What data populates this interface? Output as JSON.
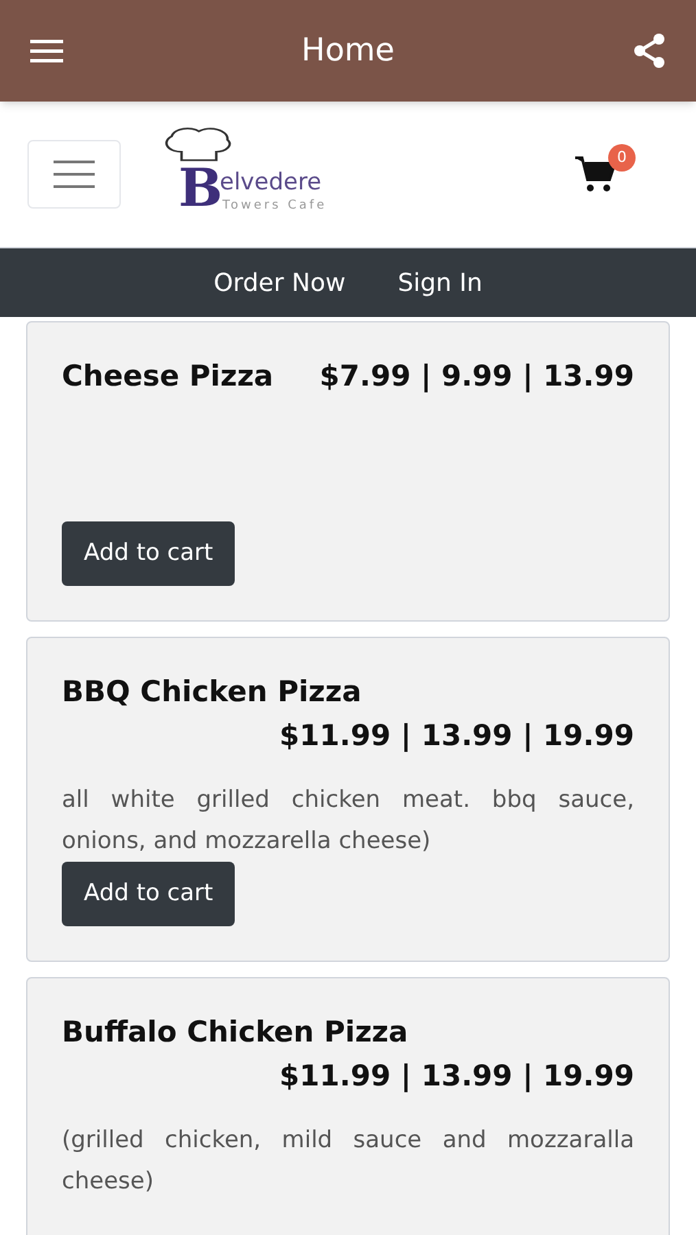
{
  "app_bar": {
    "title": "Home"
  },
  "logo": {
    "initial": "B",
    "rest": "elvedere",
    "tagline": "Towers Cafe"
  },
  "cart": {
    "count": "0"
  },
  "nav": [
    "Order Now",
    "Sign In"
  ],
  "items": [
    {
      "name": "Cheese Pizza",
      "price": "$7.99 | 9.99 | 13.99",
      "button": "Add to cart"
    },
    {
      "name": "BBQ Chicken Pizza",
      "price": "$11.99 | 13.99 | 19.99",
      "description": "all white grilled chicken meat. bbq sauce, onions, and mozzarella cheese)",
      "button": "Add to cart"
    },
    {
      "name": "Buffalo Chicken Pizza",
      "price": "$11.99 | 13.99 | 19.99",
      "description": "(grilled chicken, mild sauce and mozzaralla cheese)"
    }
  ]
}
